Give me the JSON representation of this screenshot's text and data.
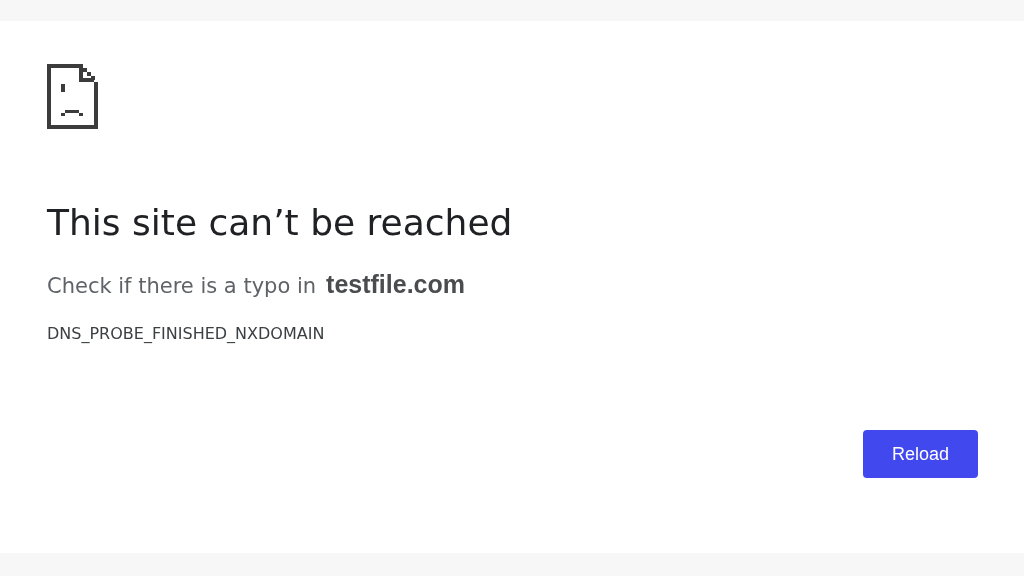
{
  "heading": "This site can’t be reached",
  "message": {
    "text": "Check if there is a typo in",
    "host": "testfile.com"
  },
  "error_code": "DNS_PROBE_FINISHED_NXDOMAIN",
  "buttons": [
    "Reload"
  ]
}
